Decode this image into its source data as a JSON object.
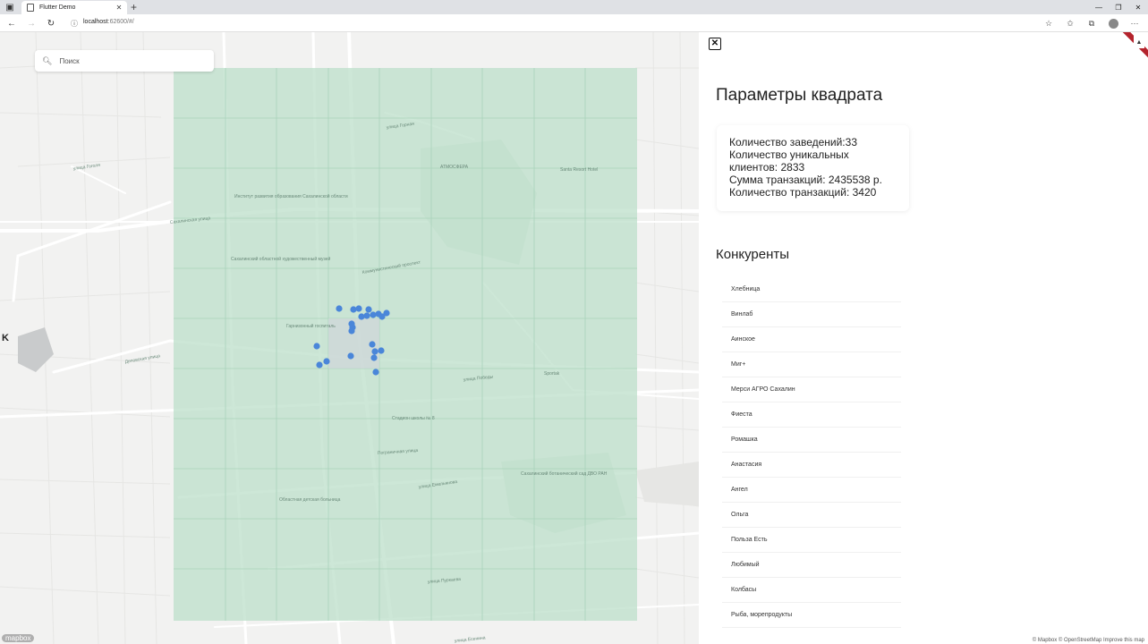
{
  "browser": {
    "tab_title": "Flutter Demo",
    "url_host": "localhost",
    "url_rest": ":62600/#/"
  },
  "map": {
    "search_placeholder": "Поиск",
    "mapbox_label": "mapbox",
    "attribution": "© Mapbox © OpenStreetMap Improve this map",
    "labels": [
      {
        "text": "АТМОСФЕРА"
      },
      {
        "text": "Santa Resort Hotel"
      },
      {
        "text": "Институт развития образования Сахалинской области"
      },
      {
        "text": "Сахалинская улица"
      },
      {
        "text": "Сахалинский областной художественный музей"
      },
      {
        "text": "Коммунистический проспект"
      },
      {
        "text": "Гарнизонный госпиталь"
      },
      {
        "text": "Деповская улица"
      },
      {
        "text": "улица Победы"
      },
      {
        "text": "Стадион школы № 8"
      },
      {
        "text": "Пограничная улица"
      },
      {
        "text": "Областная детская больница"
      },
      {
        "text": "улица Емельянова"
      },
      {
        "text": "Сахалинский ботанический сад ДВО РАН"
      },
      {
        "text": "улица Пуркаева"
      },
      {
        "text": "улица Есенина"
      },
      {
        "text": "улица Горная"
      },
      {
        "text": "Sportak"
      },
      {
        "text": "улица Гоголя"
      }
    ]
  },
  "panel": {
    "title": "Параметры квадрата",
    "stats": {
      "establishments": "Количество заведений:33",
      "clients_line1": "Количество уникальных",
      "clients_line2": "клиентов: 2833",
      "sum": "Сумма транзакций: 2435538 р.",
      "transactions": "Количество транзакций: 3420"
    },
    "competitors_title": "Конкуренты",
    "competitors": [
      "Хлебница",
      "Винлаб",
      "Аинское",
      "Миг+",
      "Мерси АГРО Сахалин",
      "Фиеста",
      "Ромашка",
      "Анастасия",
      "Ангел",
      "Ольга",
      "Польза Есть",
      "Любимый",
      "Колбасы",
      "Рыба, морепродукты"
    ]
  },
  "colors": {
    "map_bg": "#f2f2f1",
    "grid_fill": "#bfe0cc",
    "point": "#4a86d9",
    "close": "#111111"
  }
}
